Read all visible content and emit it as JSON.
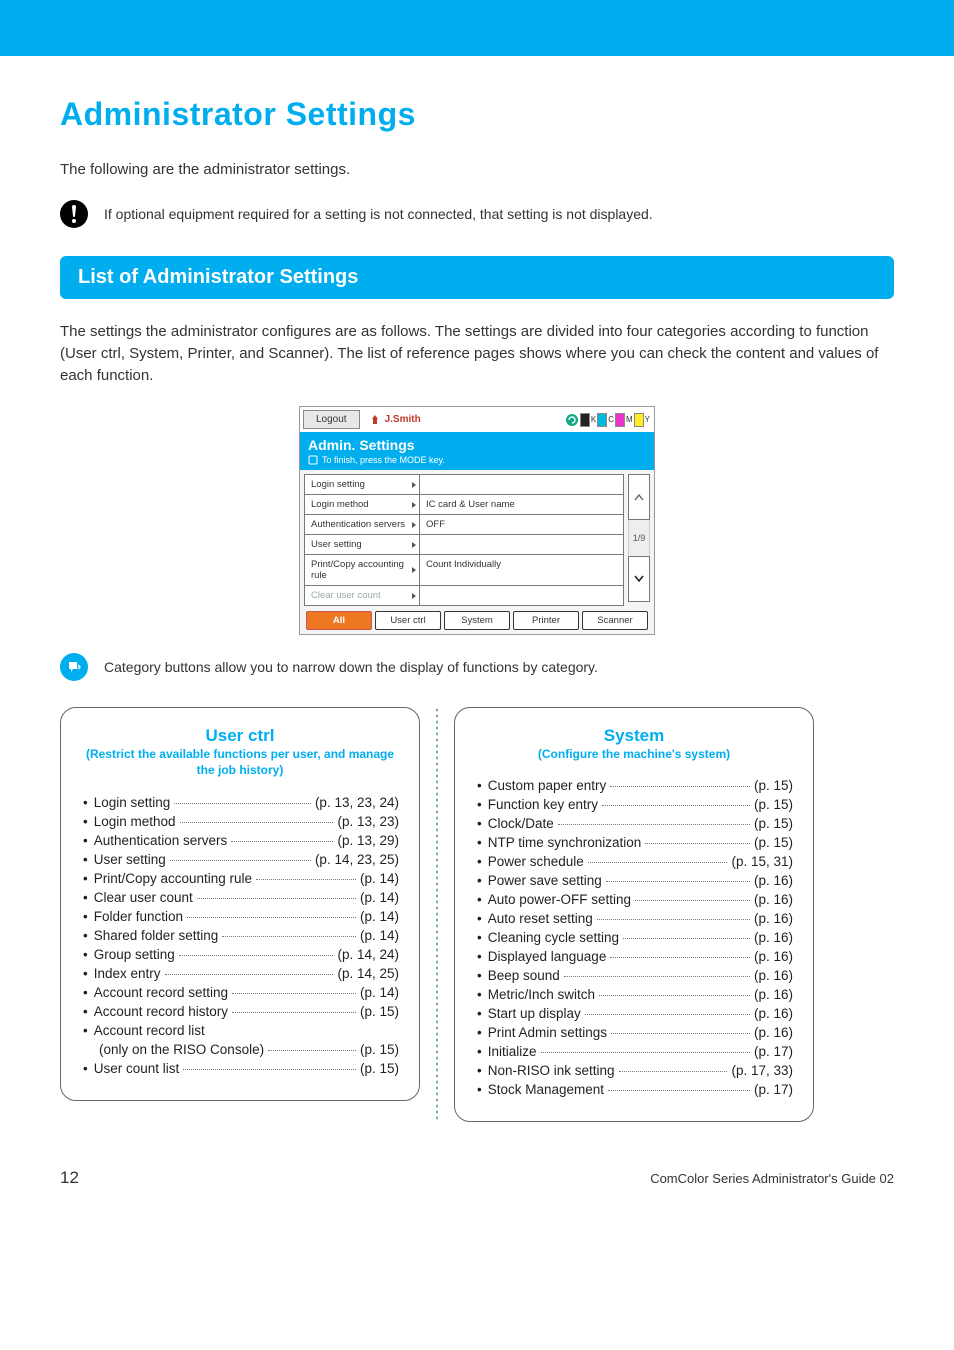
{
  "header": {
    "title": "Administrator Settings"
  },
  "intro": "The following are the administrator settings.",
  "note1": "If optional equipment required for a setting is not connected, that setting is not displayed.",
  "section_title": "List of Administrator Settings",
  "body": "The settings the administrator configures are as follows. The settings are divided into four categories according to function (User ctrl, System, Printer, and Scanner). The list of reference pages shows where you can check the content and values of each function.",
  "screen": {
    "logout": "Logout",
    "user": "J.Smith",
    "title": "Admin. Settings",
    "subtitle": "To finish, press the MODE key.",
    "rows": [
      {
        "l": "Login setting",
        "r": ""
      },
      {
        "l": "Login method",
        "r": "IC card & User name"
      },
      {
        "l": "Authentication servers",
        "r": "OFF"
      },
      {
        "l": "User setting",
        "r": ""
      },
      {
        "l": "Print/Copy accounting rule",
        "r": "Count Individually"
      },
      {
        "l": "Clear user count",
        "r": "",
        "grey": true
      }
    ],
    "page_indicator": "1/9",
    "tabs": [
      "All",
      "User ctrl",
      "System",
      "Printer",
      "Scanner"
    ],
    "active_tab": 0
  },
  "category_note": "Category buttons allow you to narrow down the display of functions by category.",
  "panel_user": {
    "title": "User ctrl",
    "sub": "(Restrict the available functions per user, and manage the job history)",
    "items": [
      {
        "label": "Login setting",
        "page": "(p. 13, 23, 24)"
      },
      {
        "label": "Login method",
        "page": "(p. 13, 23)"
      },
      {
        "label": "Authentication servers",
        "page": "(p. 13, 29)"
      },
      {
        "label": "User setting",
        "page": "(p. 14, 23, 25)"
      },
      {
        "label": "Print/Copy accounting rule",
        "page": "(p. 14)"
      },
      {
        "label": "Clear user count",
        "page": "(p. 14)"
      },
      {
        "label": "Folder function",
        "page": "(p. 14)"
      },
      {
        "label": "Shared folder setting",
        "page": "(p. 14)"
      },
      {
        "label": "Group setting",
        "page": "(p. 14, 24)"
      },
      {
        "label": "Index entry",
        "page": "(p. 14, 25)"
      },
      {
        "label": "Account record setting",
        "page": "(p. 14)"
      },
      {
        "label": "Account record history",
        "page": "(p. 15)"
      },
      {
        "label": "Account record list",
        "page": ""
      },
      {
        "label": "(only on the RISO Console)",
        "page": "(p. 15)",
        "sub": true
      },
      {
        "label": "User count list",
        "page": "(p. 15)"
      }
    ]
  },
  "panel_system": {
    "title": "System",
    "sub": "(Configure the machine's system)",
    "items": [
      {
        "label": "Custom paper entry",
        "page": "(p. 15)"
      },
      {
        "label": "Function key entry",
        "page": "(p. 15)"
      },
      {
        "label": "Clock/Date",
        "page": "(p. 15)"
      },
      {
        "label": "NTP time synchronization",
        "page": "(p. 15)"
      },
      {
        "label": "Power schedule",
        "page": "(p. 15, 31)"
      },
      {
        "label": "Power save setting",
        "page": "(p. 16)"
      },
      {
        "label": "Auto power-OFF setting",
        "page": "(p. 16)"
      },
      {
        "label": "Auto reset setting",
        "page": "(p. 16)"
      },
      {
        "label": "Cleaning cycle setting",
        "page": "(p. 16)"
      },
      {
        "label": "Displayed language",
        "page": "(p. 16)"
      },
      {
        "label": "Beep sound",
        "page": "(p. 16)"
      },
      {
        "label": "Metric/Inch switch",
        "page": "(p. 16)"
      },
      {
        "label": "Start up display",
        "page": "(p. 16)"
      },
      {
        "label": "Print Admin settings",
        "page": "(p. 16)"
      },
      {
        "label": "Initialize",
        "page": "(p. 17)"
      },
      {
        "label": "Non-RISO ink setting",
        "page": "(p. 17, 33)"
      },
      {
        "label": "Stock Management",
        "page": "(p. 17)"
      }
    ]
  },
  "footer": {
    "page_number": "12",
    "doc_label": "ComColor Series  Administrator's Guide  02"
  }
}
